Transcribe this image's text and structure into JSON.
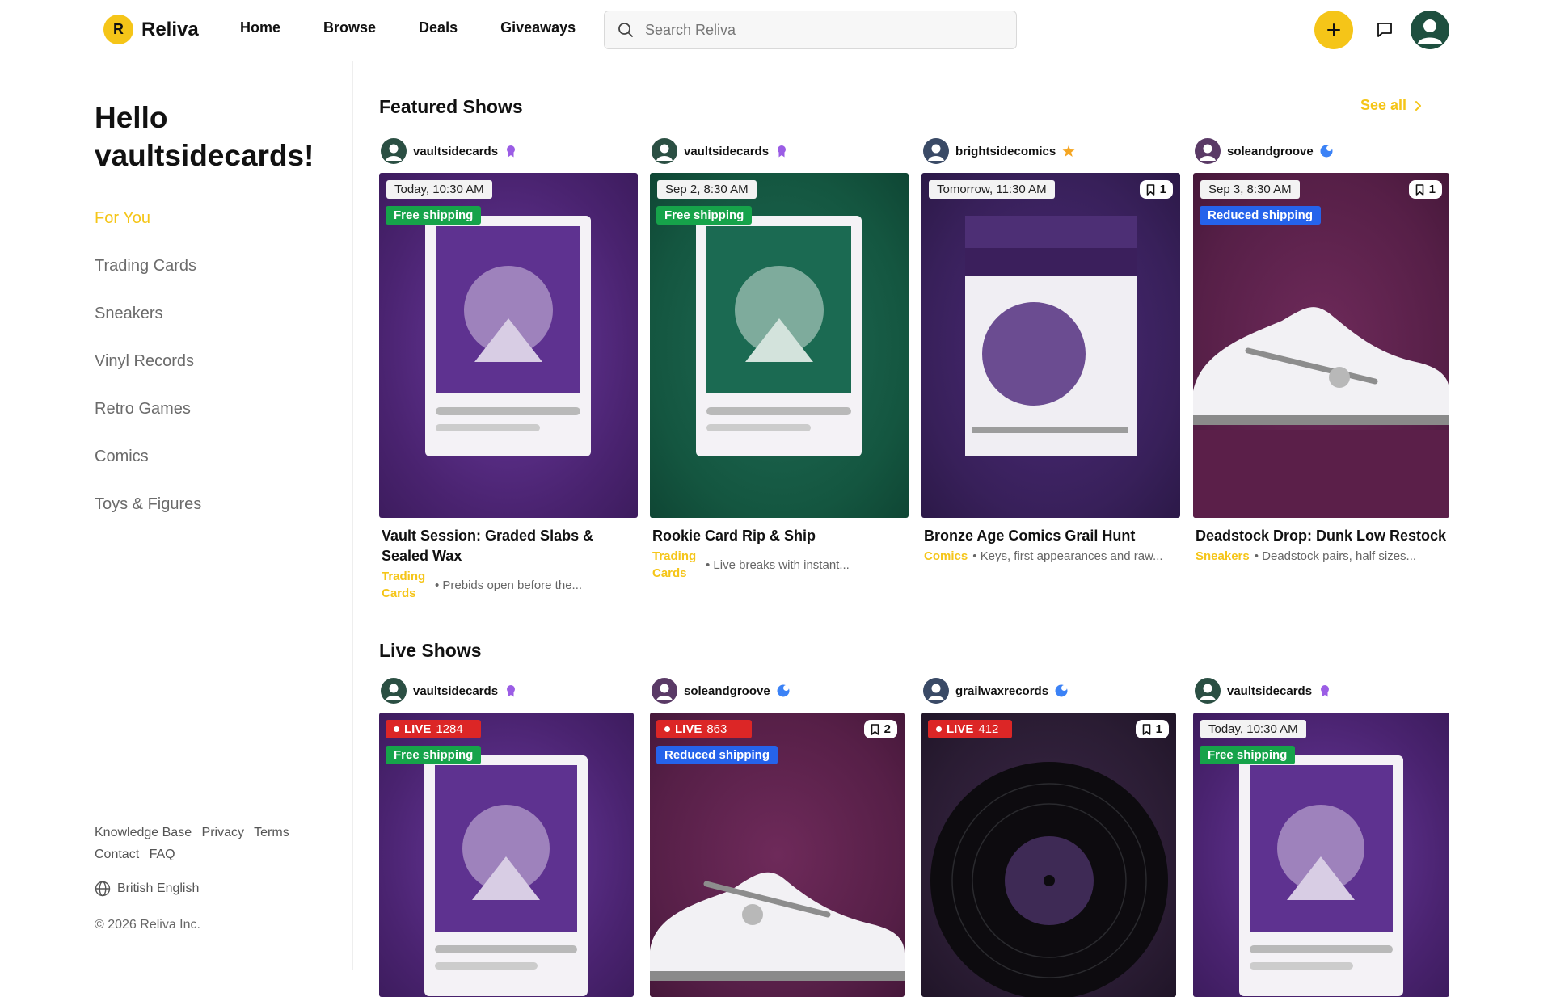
{
  "brand": {
    "logo_letter": "R",
    "name": "Reliva",
    "accent": "#f5c518"
  },
  "nav": [
    "Home",
    "Browse",
    "Deals",
    "Giveaways"
  ],
  "search": {
    "placeholder": "Search Reliva"
  },
  "sidebar": {
    "greeting": "Hello vaultsidecards!",
    "categories": [
      "For You",
      "Trading Cards",
      "Sneakers",
      "Vinyl Records",
      "Retro Games",
      "Comics",
      "Toys & Figures"
    ],
    "active_category": "For You",
    "footer_links": [
      "Knowledge Base",
      "Privacy",
      "Terms",
      "Contact",
      "FAQ"
    ],
    "language": "British English",
    "copyright": "© 2026 Reliva Inc."
  },
  "featured": {
    "title": "Featured Shows",
    "see_all": "See all",
    "cards": [
      {
        "seller": "vaultsidecards",
        "badge": "purple-ribbon-icon",
        "date": "Today, 10:30 AM",
        "shipping": "Free shipping",
        "title": "Vault Session: Graded Slabs & Sealed Wax",
        "category": "Trading Cards",
        "desc": "• Prebids open before the..."
      },
      {
        "seller": "vaultsidecards",
        "badge": "purple-ribbon-icon",
        "date": "Sep 2, 8:30 AM",
        "shipping": "Free shipping",
        "title": "Rookie Card Rip & Ship",
        "category": "Trading Cards",
        "desc": "• Live breaks with instant..."
      },
      {
        "seller": "brightsidecomics",
        "badge": "star-icon",
        "date": "Tomorrow, 11:30 AM",
        "saves": "1",
        "title": "Bronze Age Comics Grail Hunt",
        "category": "Comics",
        "desc": "• Keys, first appearances and raw..."
      },
      {
        "seller": "soleandgroove",
        "badge": "verified-icon",
        "date": "Sep 3, 8:30 AM",
        "saves": "1",
        "shipping": "Reduced shipping",
        "title": "Deadstock Drop: Dunk Low Restock",
        "category": "Sneakers",
        "desc": "• Deadstock pairs, half sizes..."
      }
    ]
  },
  "live": {
    "title": "Live Shows",
    "cards": [
      {
        "seller": "vaultsidecards",
        "badge": "purple-ribbon-icon",
        "live": "LIVE",
        "viewers": "1284",
        "shipping": "Free shipping"
      },
      {
        "seller": "soleandgroove",
        "badge": "verified-icon",
        "live": "LIVE",
        "viewers": "863",
        "saves": "2",
        "shipping": "Reduced shipping"
      },
      {
        "seller": "grailwaxrecords",
        "badge": "verified-icon",
        "live": "LIVE",
        "viewers": "412",
        "saves": "1"
      },
      {
        "seller": "vaultsidecards",
        "badge": "purple-ribbon-icon",
        "date": "Today, 10:30 AM",
        "shipping": "Free shipping"
      }
    ]
  }
}
